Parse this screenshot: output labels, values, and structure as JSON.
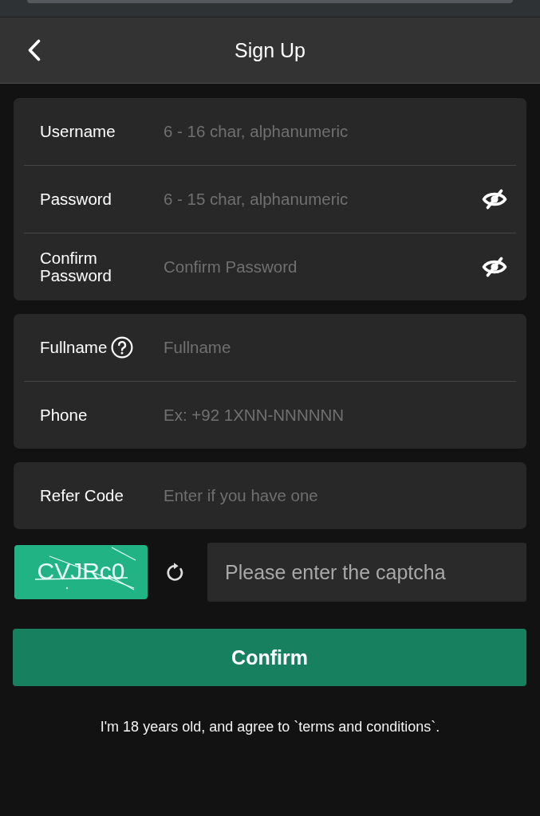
{
  "header": {
    "title": "Sign Up"
  },
  "groups": [
    {
      "fields": [
        {
          "label": "Username",
          "placeholder": "6 - 16 char, alphanumeric",
          "kind": "text"
        },
        {
          "label": "Password",
          "placeholder": "6 - 15 char, alphanumeric",
          "kind": "password"
        },
        {
          "label": "Confirm Password",
          "placeholder": "Confirm Password",
          "kind": "password"
        }
      ]
    },
    {
      "fields": [
        {
          "label": "Fullname",
          "placeholder": "Fullname",
          "kind": "help"
        },
        {
          "label": "Phone",
          "placeholder": "Ex: +92 1XNN-NNNNNN",
          "kind": "text"
        }
      ]
    },
    {
      "fields": [
        {
          "label": "Refer Code",
          "placeholder": "Enter if you have one",
          "kind": "text"
        }
      ]
    }
  ],
  "captcha": {
    "code": "CVJRc0",
    "placeholder": "Please enter the captcha"
  },
  "confirm_button": {
    "label": "Confirm"
  },
  "terms": "I'm 18 years old, and agree to `terms and conditions`."
}
